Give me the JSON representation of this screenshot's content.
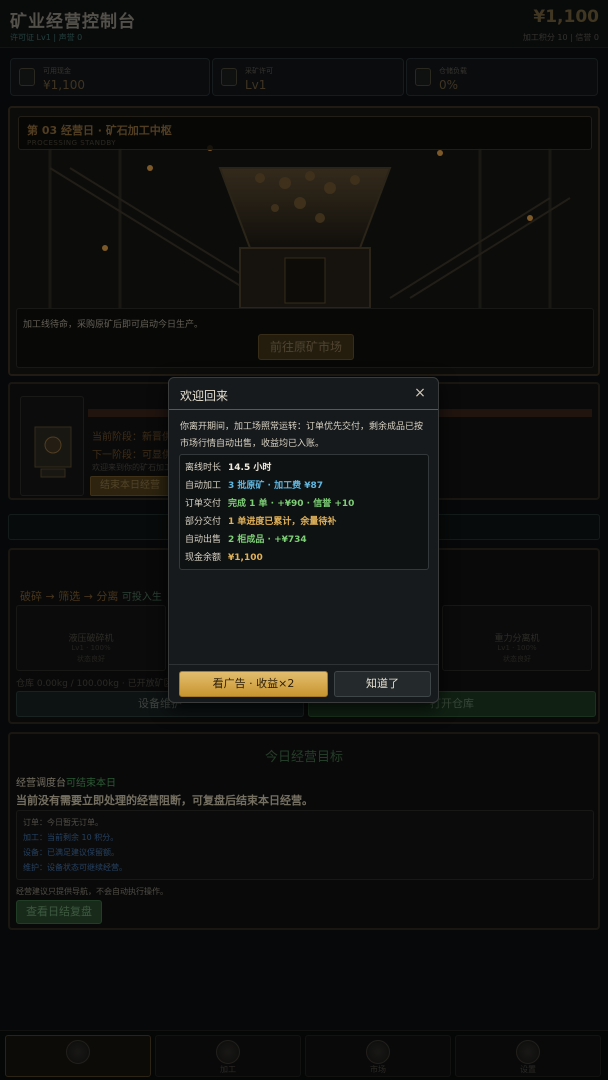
{
  "header": {
    "title": "矿业经营控制台",
    "license_line": "许可证 Lv1 | 声誉 0",
    "money": "¥1,100",
    "points_line": "加工积分 10 | 信誉 0"
  },
  "stats": [
    {
      "label": "可用现金",
      "value": "¥1,100",
      "icon": "cash-icon"
    },
    {
      "label": "采矿许可",
      "value": "Lv1",
      "icon": "license-icon"
    },
    {
      "label": "仓储负载",
      "value": "0%",
      "icon": "storage-icon"
    }
  ],
  "hero": {
    "day_title": "第 03 经营日 · 矿石加工中枢",
    "day_subtitle": "PROCESSING STANDBY",
    "message": "加工线待命，采购原矿后即可启动今日生产。",
    "goto_button": "前往原矿市场"
  },
  "briefing": {
    "current_stage": "当前阶段：新晋供",
    "next_stage": "下一阶段：可显供",
    "welcome": "欢迎来到你的矿石加工",
    "end_button": "结束本日经营"
  },
  "equipment": {
    "flow": "破碎 → 筛选 → 分离",
    "flow_hint": "可投入生",
    "machines": [
      {
        "name": "液压破碎机",
        "level": "Lv1 · 100%",
        "status": "状态良好"
      },
      {
        "name": "重力分离机",
        "level": "Lv1 · 100%",
        "status": "状态良好"
      }
    ],
    "storage": "仓库 0.00kg / 100.00kg · 已开放矿区",
    "maintain_button": "设备维护",
    "warehouse_button": "打开仓库"
  },
  "goals": {
    "title": "今日经营目标",
    "dispatch_prefix": "经营调度台",
    "dispatch_status": "可结束本日",
    "headline": "当前没有需要立即处理的经营阻断，可复盘后结束本日经营。",
    "tips": [
      {
        "text": "订单：今日暂无订单。",
        "color": "#8a8478"
      },
      {
        "text": "加工：当前剩余 10 积分。",
        "color": "#3f6fa8"
      },
      {
        "text": "设备：已满足建议保留额。",
        "color": "#3f6fa8"
      },
      {
        "text": "维护：设备状态可继续经营。",
        "color": "#3f6fa8"
      }
    ],
    "note": "经营建议只提供导航，不会自动执行操作。",
    "review_button": "查看日结复盘"
  },
  "nav": [
    {
      "label": "",
      "icon": "home-icon"
    },
    {
      "label": "加工",
      "icon": "process-icon"
    },
    {
      "label": "市场",
      "icon": "market-icon"
    },
    {
      "label": "设置",
      "icon": "settings-icon"
    }
  ],
  "modal": {
    "title": "欢迎回来",
    "close": "×",
    "intro": "你离开期间，加工场照常运转：订单优先交付，剩余成品已按市场行情自动出售，收益均已入账。",
    "rows": [
      {
        "key": "离线时长",
        "value": "14.5 小时",
        "tone": "white"
      },
      {
        "key": "自动加工",
        "value": "3 批原矿 · 加工费 ¥87",
        "tone": "blue"
      },
      {
        "key": "订单交付",
        "value": "完成 1 单 · +¥90 · 信誉 +10",
        "tone": "green"
      },
      {
        "key": "部分交付",
        "value": "1 单进度已累计，余量待补",
        "tone": "gold"
      },
      {
        "key": "自动出售",
        "value": "2 柜成品 · +¥734",
        "tone": "green"
      },
      {
        "key": "现金余额",
        "value": "¥1,100",
        "tone": "gold"
      }
    ],
    "ad_button": "看广告 · 收益×2",
    "ok_button": "知道了"
  }
}
